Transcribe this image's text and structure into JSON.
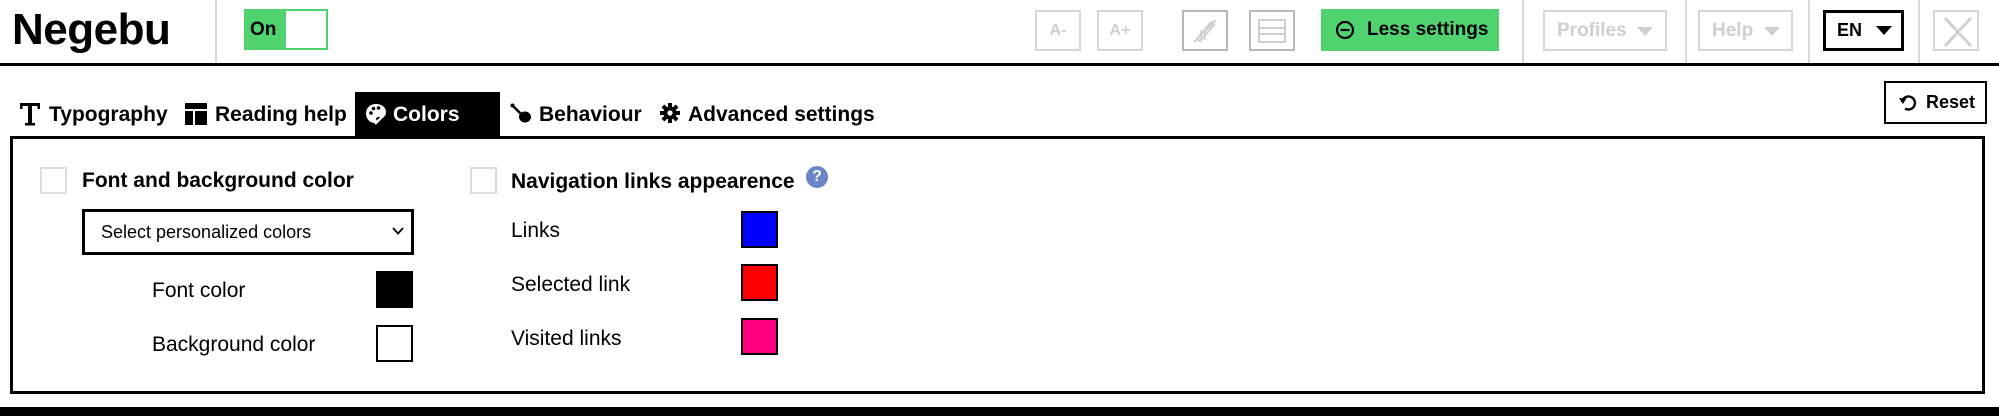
{
  "app": {
    "brand": "Negebu"
  },
  "toolbar": {
    "toggle_label": "On",
    "decrease_font_label": "A-",
    "increase_font_label": "A+",
    "less_settings_label": "Less settings",
    "profiles_label": "Profiles",
    "help_label": "Help",
    "language_label": "EN"
  },
  "tabs": [
    {
      "label": "Typography",
      "icon": "typography-icon",
      "active": false
    },
    {
      "label": "Reading help",
      "icon": "layout-icon",
      "active": false
    },
    {
      "label": "Colors",
      "icon": "palette-icon",
      "active": true
    },
    {
      "label": "Behaviour",
      "icon": "pointer-icon",
      "active": false
    },
    {
      "label": "Advanced settings",
      "icon": "gear-icon",
      "active": false
    }
  ],
  "reset_label": "Reset",
  "font_background": {
    "title": "Font and background color",
    "checked": false,
    "select_value": "Select personalized colors",
    "rows": [
      {
        "label": "Font color",
        "color": "#000000"
      },
      {
        "label": "Background color",
        "color": "#ffffff"
      }
    ]
  },
  "nav_links": {
    "title": "Navigation links appearence",
    "checked": false,
    "rows": [
      {
        "label": "Links",
        "color": "#0000ff"
      },
      {
        "label": "Selected link",
        "color": "#ff0000"
      },
      {
        "label": "Visited links",
        "color": "#ff0080"
      }
    ]
  },
  "colors": {
    "accent_green": "#50d36f",
    "help_blue": "#6b85c8",
    "disabled_gray": "#cfcfcf"
  }
}
